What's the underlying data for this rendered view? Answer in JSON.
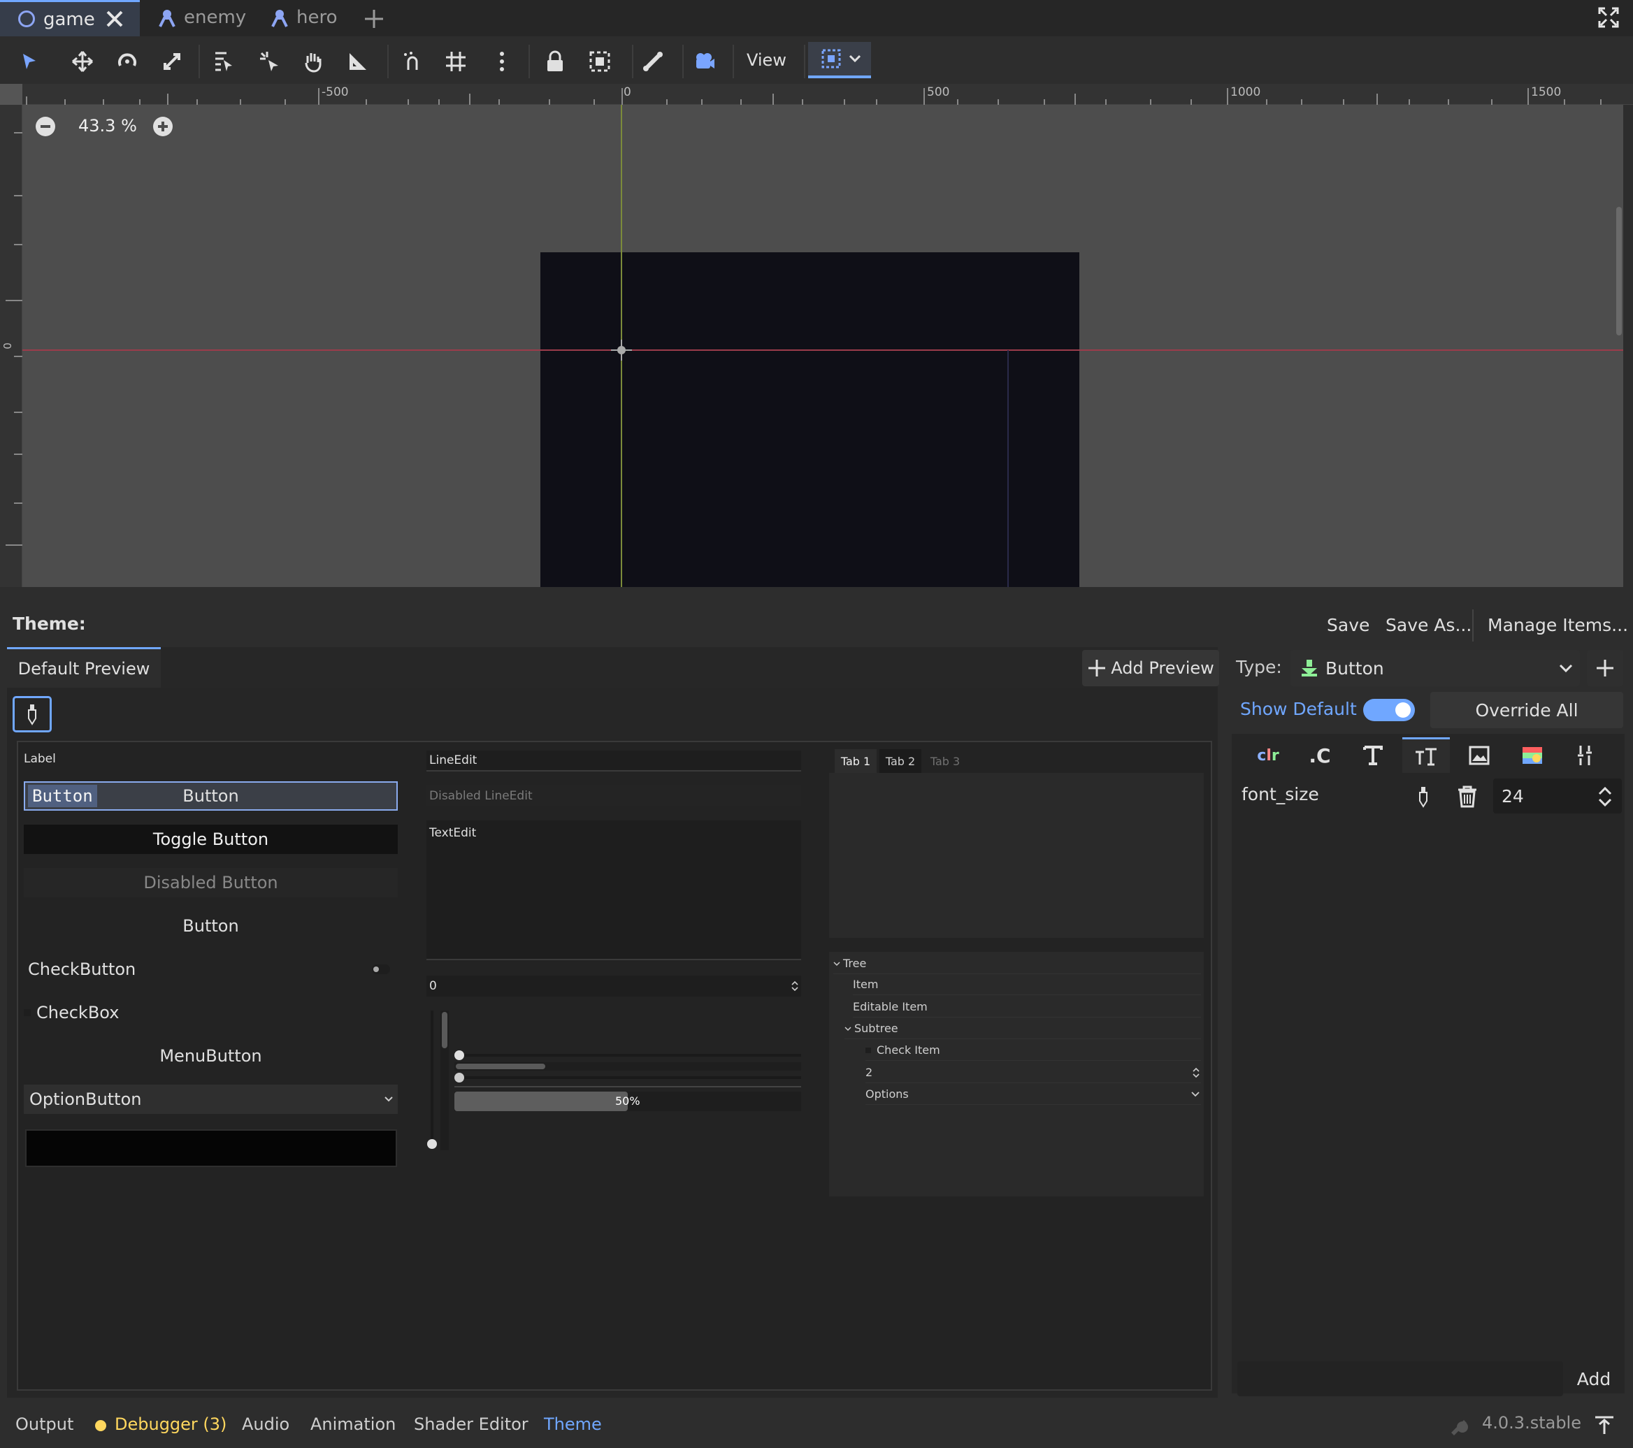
{
  "scene_tabs": [
    {
      "label": "game",
      "icon": "node2d-circle-icon",
      "active": true
    },
    {
      "label": "enemy",
      "icon": "character-icon"
    },
    {
      "label": "hero",
      "icon": "character-icon"
    }
  ],
  "toolbar": {
    "view_label": "View"
  },
  "viewport": {
    "zoom_label": "43.3 %",
    "ruler_ticks": [
      "-500",
      "0",
      "500",
      "1000",
      "1500"
    ],
    "vruler_tick": "0"
  },
  "theme": {
    "title": "Theme:",
    "save_label": "Save",
    "save_as_label": "Save As...",
    "manage_items_label": "Manage Items...",
    "preview_tab": "Default Preview",
    "add_preview_label": "Add Preview",
    "type_label": "Type:",
    "type_value": "Button",
    "show_default_label": "Show Default",
    "override_all_label": "Override All",
    "prop_name": "font_size",
    "prop_value": "24",
    "add_label": "Add"
  },
  "preview": {
    "label": "Label",
    "button_focus": "Button",
    "button": "Button",
    "toggle_button": "Toggle Button",
    "disabled_button": "Disabled Button",
    "flat_button": "Button",
    "check_button": "CheckButton",
    "checkbox": "CheckBox",
    "menu_button": "MenuButton",
    "option_button": "OptionButton",
    "line_edit": "LineEdit",
    "disabled_line_edit": "Disabled LineEdit",
    "text_edit": "TextEdit",
    "spinbox_value": "0",
    "progress_text": "50%",
    "progress_value": 0.5,
    "tabs": [
      "Tab 1",
      "Tab 2",
      "Tab 3"
    ],
    "tree": {
      "root": "Tree",
      "item": "Item",
      "editable": "Editable Item",
      "subtree": "Subtree",
      "check_item": "Check Item",
      "range_value": "2",
      "options": "Options"
    }
  },
  "bottom": {
    "tabs": [
      "Output",
      "Debugger (3)",
      "Audio",
      "Animation",
      "Shader Editor",
      "Theme"
    ],
    "version": "4.0.3.stable"
  },
  "colors": {
    "accent": "#70a7ff",
    "debugger": "#ffd75e",
    "scene_bg": "#0f0f17",
    "viewport_bg": "#4d4d4d"
  }
}
